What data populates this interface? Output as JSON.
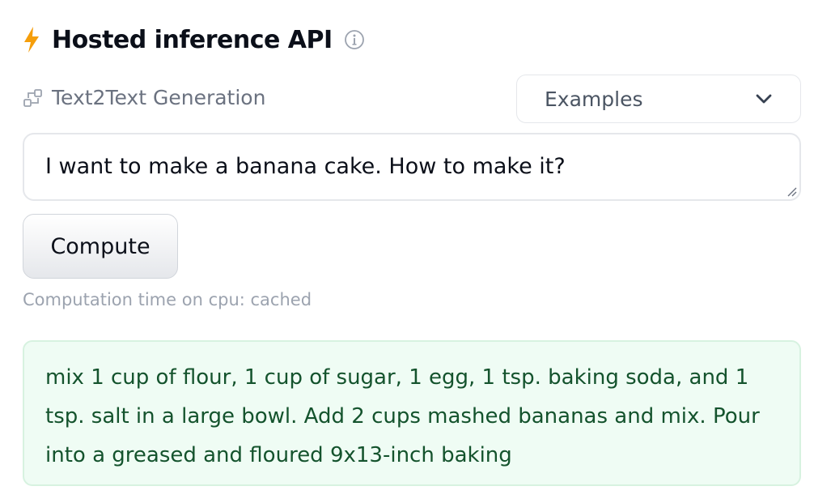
{
  "header": {
    "title": "Hosted inference API",
    "icons": {
      "leading": "lightning-bolt-icon",
      "trailing": "info-icon"
    },
    "accent_color": "#f59e0b"
  },
  "task": {
    "icon": "task-type-icon",
    "label": "Text2Text Generation"
  },
  "examples": {
    "label": "Examples",
    "icon": "chevron-down-icon"
  },
  "input": {
    "value": "I want to make a banana cake. How to make it?"
  },
  "compute": {
    "label": "Compute"
  },
  "status": {
    "text": "Computation time on cpu: cached"
  },
  "output": {
    "text": "mix 1 cup of flour, 1 cup of sugar, 1 egg, 1 tsp. baking soda, and 1 tsp. salt in a large bowl. Add 2 cups mashed bananas and mix. Pour into a greased and floured 9x13-inch baking",
    "background_color": "#effcf4",
    "text_color": "#14532d"
  }
}
